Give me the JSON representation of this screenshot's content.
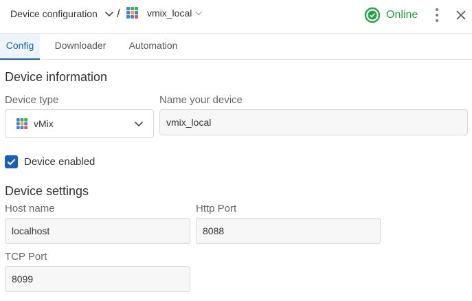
{
  "header": {
    "breadcrumb_root": "Device configuration",
    "separator": "/",
    "device_name": "vmix_local",
    "status": "Online",
    "status_color": "#25a244"
  },
  "tabs": [
    {
      "label": "Config",
      "active": true
    },
    {
      "label": "Downloader",
      "active": false
    },
    {
      "label": "Automation",
      "active": false
    }
  ],
  "device_information": {
    "title": "Device information",
    "device_type_label": "Device type",
    "device_type_value": "vMix",
    "device_name_label": "Name your device",
    "device_name_value": "vmix_local",
    "enabled_label": "Device enabled",
    "enabled": true
  },
  "device_settings": {
    "title": "Device settings",
    "host_name_label": "Host name",
    "host_name_value": "localhost",
    "http_port_label": "Http Port",
    "http_port_value": "8088",
    "tcp_port_label": "TCP Port",
    "tcp_port_value": "8099"
  },
  "icons": {
    "device_grid": "grid-icon",
    "status": "check-circle-icon",
    "menu": "kebab-icon",
    "close": "close-icon"
  },
  "accent_color": "#1a5fb4"
}
